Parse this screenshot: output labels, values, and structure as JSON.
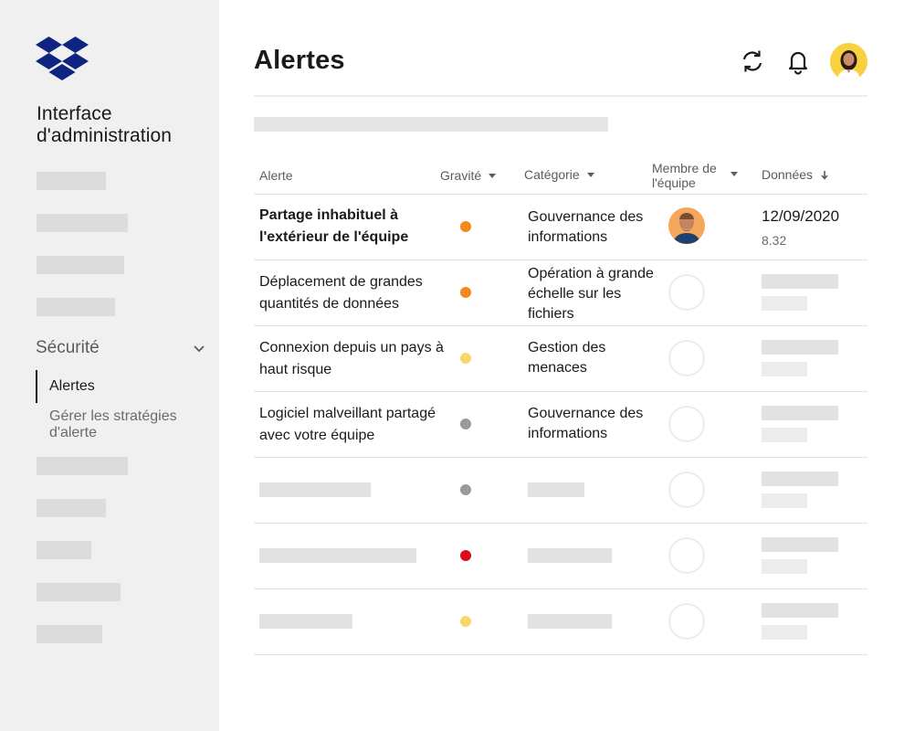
{
  "brand": {
    "app_title_line1": "Interface",
    "app_title_line2": "d'administration",
    "logo_icon": "dropbox-logo",
    "color": "#0d2481"
  },
  "sidebar": {
    "section_label": "Sécurité",
    "subnav": [
      {
        "label": "Alertes",
        "active": true
      },
      {
        "label": "Gérer les stratégies d'alerte",
        "active": false
      }
    ]
  },
  "header": {
    "title": "Alertes",
    "icons": [
      "refresh-icon",
      "bell-icon"
    ],
    "avatar_bg": "#f7d23e"
  },
  "table": {
    "columns": [
      {
        "label": "Alerte",
        "sortable": false
      },
      {
        "label": "Gravité",
        "sortable": true
      },
      {
        "label": "Catégorie",
        "sortable": true
      },
      {
        "label": "Membre de l'équipe",
        "sortable": true
      },
      {
        "label": "Données",
        "sort": "descending"
      }
    ],
    "rows": [
      {
        "alert": "Partage inhabituel à l'extérieur de l'équipe",
        "severity": "orange",
        "category": "Gouvernance des informations",
        "date": "12/09/2020",
        "size": "8.32"
      },
      {
        "alert": "Déplacement de grandes quantités de données",
        "severity": "orange",
        "category": "Opération à grande échelle sur les fichiers"
      },
      {
        "alert": "Connexion depuis un pays à haut risque",
        "severity": "yellow",
        "category": "Gestion des menaces"
      },
      {
        "alert": "Logiciel malveillant partagé avec votre équipe",
        "severity": "gray",
        "category": "Gouvernance des informations"
      },
      {
        "severity": "gray"
      },
      {
        "severity": "red"
      },
      {
        "severity": "yellow"
      }
    ]
  },
  "colors": {
    "orange": "#f48a1e",
    "yellow": "#f9d66b",
    "gray": "#9a9a9a",
    "red": "#d80b1e"
  }
}
